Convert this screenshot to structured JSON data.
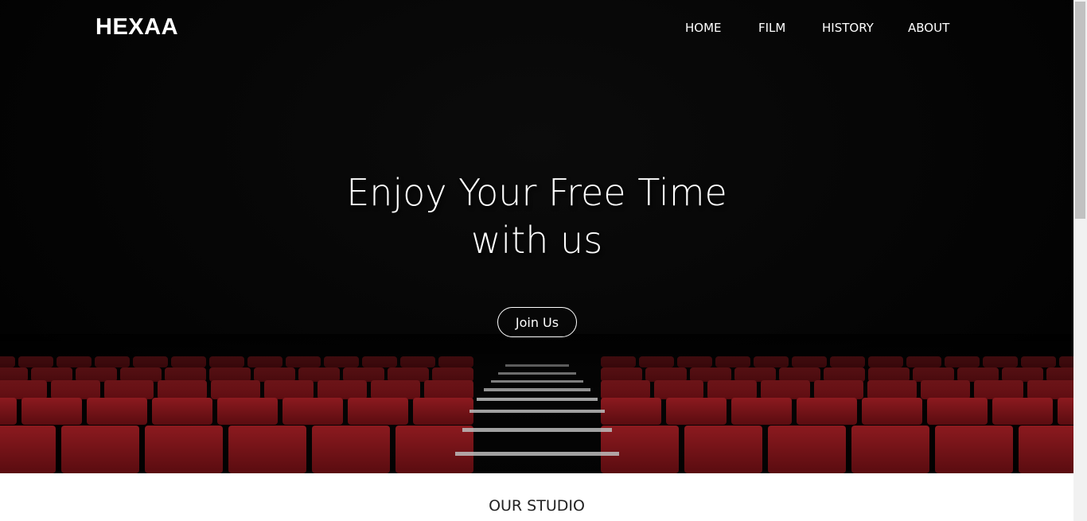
{
  "nav": {
    "brand": "HEXAA",
    "links": [
      "HOME",
      "FILM",
      "HISTORY",
      "ABOUT"
    ]
  },
  "hero": {
    "title_line1": "Enjoy Your Free Time",
    "title_line2": "with us",
    "cta_label": "Join Us",
    "background_theme": "dark cinema with red seats",
    "seat_color": "#7a1418"
  },
  "section": {
    "title": "OUR STUDIO"
  }
}
